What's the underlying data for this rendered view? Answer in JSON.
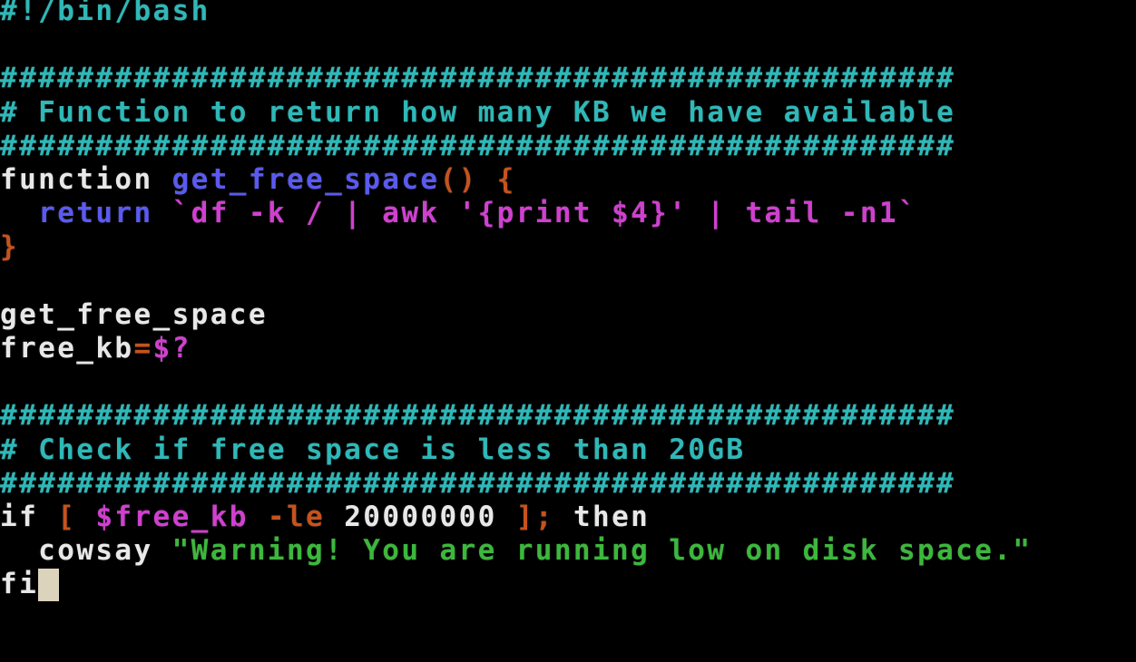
{
  "editor": {
    "filename": "",
    "colors": {
      "background": "#000000",
      "plain": "#e8e8e8",
      "comment": "#2fb8b8",
      "function_name": "#5a5af2",
      "keyword_blue": "#5a5af2",
      "bracket": "#c6531c",
      "command_sub": "#d040d0",
      "variable": "#d040d0",
      "string": "#3cb83c",
      "cursor": "#dcd3bd"
    },
    "lines": [
      {
        "tokens": [
          {
            "t": "#!/bin/bash",
            "c": "#2fb8b8"
          }
        ]
      },
      {
        "tokens": []
      },
      {
        "tokens": [
          {
            "t": "##################################################",
            "c": "#2fb8b8"
          }
        ]
      },
      {
        "tokens": [
          {
            "t": "# Function to return how many KB we have available",
            "c": "#2fb8b8"
          }
        ]
      },
      {
        "tokens": [
          {
            "t": "##################################################",
            "c": "#2fb8b8"
          }
        ]
      },
      {
        "tokens": [
          {
            "t": "function ",
            "c": "#e8e8e8"
          },
          {
            "t": "get_free_space",
            "c": "#5a5af2"
          },
          {
            "t": "() {",
            "c": "#c6531c"
          }
        ]
      },
      {
        "tokens": [
          {
            "t": "  return ",
            "c": "#5a5af2"
          },
          {
            "t": "`df -k / | awk '{print $4}' | tail -n1`",
            "c": "#d040d0"
          }
        ]
      },
      {
        "tokens": [
          {
            "t": "}",
            "c": "#c6531c"
          }
        ]
      },
      {
        "tokens": []
      },
      {
        "tokens": [
          {
            "t": "get_free_space",
            "c": "#e8e8e8"
          }
        ]
      },
      {
        "tokens": [
          {
            "t": "free_kb",
            "c": "#e8e8e8"
          },
          {
            "t": "=",
            "c": "#c6531c"
          },
          {
            "t": "$?",
            "c": "#d040d0"
          }
        ]
      },
      {
        "tokens": []
      },
      {
        "tokens": [
          {
            "t": "##################################################",
            "c": "#2fb8b8"
          }
        ]
      },
      {
        "tokens": [
          {
            "t": "# Check if free space is less than 20GB",
            "c": "#2fb8b8"
          }
        ]
      },
      {
        "tokens": [
          {
            "t": "##################################################",
            "c": "#2fb8b8"
          }
        ]
      },
      {
        "tokens": [
          {
            "t": "if ",
            "c": "#e8e8e8"
          },
          {
            "t": "[ ",
            "c": "#c6531c"
          },
          {
            "t": "$free_kb",
            "c": "#d040d0"
          },
          {
            "t": " -le ",
            "c": "#c6531c"
          },
          {
            "t": "20000000",
            "c": "#e8e8e8"
          },
          {
            "t": " ]; ",
            "c": "#c6531c"
          },
          {
            "t": "then",
            "c": "#e8e8e8"
          }
        ]
      },
      {
        "tokens": [
          {
            "t": "  cowsay ",
            "c": "#e8e8e8"
          },
          {
            "t": "\"Warning! You are running low on disk space.\"",
            "c": "#3cb83c"
          }
        ]
      },
      {
        "tokens": [
          {
            "t": "fi",
            "c": "#e8e8e8"
          }
        ],
        "cursor": true
      }
    ]
  }
}
